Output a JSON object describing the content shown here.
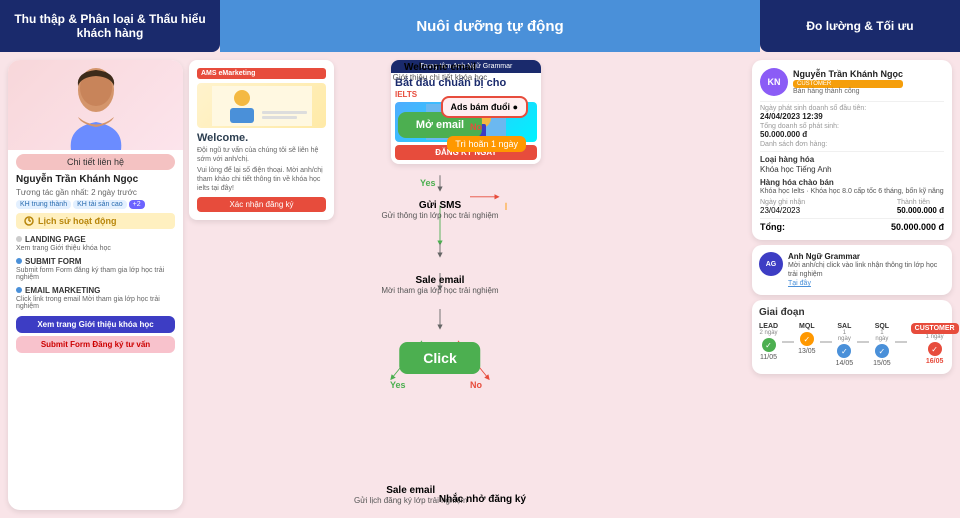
{
  "header": {
    "left": "Thu thập & Phân loại\n& Thấu hiểu khách hàng",
    "middle": "Nuôi dưỡng tự động",
    "right": "Đo lường & Tối ưu"
  },
  "left_panel": {
    "contact_btn": "Chi tiết liên hệ",
    "customer_name": "Nguyễn Trần Khánh Ngọc",
    "activity_desc1": "Tương tác gần nhất: 2 ngày trước",
    "tag1": "KH trung thành",
    "tag2": "KH tài sản cao",
    "tag3": "+2",
    "activity_header": "Lịch sử hoạt động",
    "activity1_title": "LANDING PAGE",
    "activity1_desc": "Xem trang Giới thiệu khóa học",
    "activity2_title": "SUBMIT FORM",
    "activity2_desc": "Submit form Form đăng ký tham gia lớp học trải nghiệm",
    "activity3_title": "EMAIL MARKETING",
    "activity3_desc": "Click link trong email Mời tham gia lớp học trải nghiệm",
    "btn_primary": "Xem trang Giới thiệu khóa học",
    "btn_secondary": "Submit Form Đăng ký tư vấn"
  },
  "email_preview": {
    "header": "AMS eMarketing",
    "welcome": "Welcome.",
    "body1": "Đội ngũ tư vấn của chúng tôi sẽ liên hệ sớm với anh/chị.",
    "body2": "Vui lòng để lại số điện thoại. Mời anh/chị tham khảo chi tiết thông tin về khóa học ielts tại đây!",
    "confirm_btn": "Xác nhận đăng ký"
  },
  "ielts_ad": {
    "header": "Trung tâm Anh Ngữ Grammar",
    "title": "Bắt đầu chuẩn bị cho",
    "subtitle": "IELTS",
    "register_btn": "ĐĂNG KÝ NGAY"
  },
  "flow": {
    "welcome_email_title": "Welcome email",
    "welcome_email_desc": "Giới thiệu chi tiết khóa học",
    "open_email": "Mở email",
    "delay": "Trì hoãn 1 ngày",
    "ads": "Ads bám đuổi",
    "send_sms_title": "Gửi SMS",
    "send_sms_desc": "Gửi thông tin lớp học trải nghiệm",
    "sale_email_title": "Sale email",
    "sale_email_desc": "Mời tham gia lớp học trải nghiệm",
    "click": "Click",
    "yes": "Yes",
    "no": "No",
    "bottom_yes_title": "Sale email",
    "bottom_yes_desc": "Gửi lịch đăng ký lớp trải nghiệm",
    "bottom_no_title": "Nhắc nhở đăng ký"
  },
  "chat_bubble": {
    "avatar": "AG",
    "sender": "Anh Ngữ Grammar",
    "text": "Mời anh/chị click vào link nhận thông tin lớp học trải nghiệm",
    "link": "Tại đây"
  },
  "right_panel": {
    "avatar_initials": "KN",
    "customer_name": "Nguyễn Trần Khánh Ngọc",
    "badge": "CUSTOMER",
    "subtitle": "Bán hàng thành công",
    "date_label": "Ngày phát sinh doanh số đầu tiên:",
    "date_value": "24/04/2023 12:39",
    "revenue_label": "Tổng doanh số phát sinh:",
    "revenue_value": "50.000.000 đ",
    "orders_label": "Danh sách đơn hàng:",
    "product_type": "Loại hàng hóa",
    "product_name": "Khóa học Tiếng Anh",
    "goods_label": "Hàng hóa chào bán",
    "goods_value": "Khóa học Ielts · Khóa học 8.0 cấp tốc 6 tháng, bốn kỹ năng",
    "date_received_label": "Ngày ghi nhận",
    "date_received_value": "23/04/2023",
    "total_label": "Thành tiên",
    "total_value": "50.000.000 đ",
    "grand_total_label": "Tổng:",
    "grand_total_value": "50.000.000 đ"
  },
  "stages": {
    "title": "Giai đoạn",
    "items": [
      {
        "name": "LEAD",
        "days": "2 ngày",
        "date": "11/05"
      },
      {
        "name": "MQL",
        "days": "",
        "date": "13/05"
      },
      {
        "name": "SAL",
        "days": "1 ngày",
        "date": "14/05"
      },
      {
        "name": "SQL",
        "days": "1 ngày",
        "date": "15/05"
      },
      {
        "name": "CUSTOMER",
        "days": "1 ngày",
        "date": "16/05"
      }
    ]
  }
}
